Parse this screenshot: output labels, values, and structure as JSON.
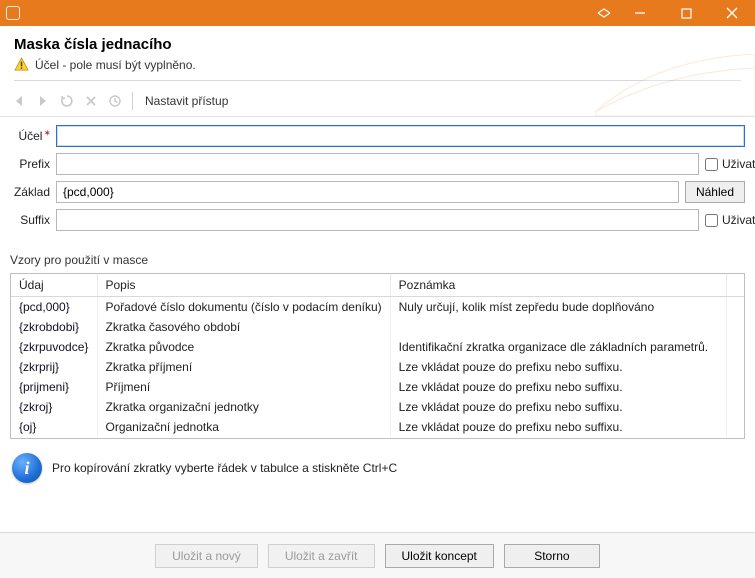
{
  "header": {
    "title": "Maska čísla jednacího",
    "warning": "Účel - pole musí být vyplněno."
  },
  "toolbar": {
    "access_label": "Nastavit přístup"
  },
  "form": {
    "ucel_label": "Účel",
    "ucel_value": "",
    "prefix_label": "Prefix",
    "prefix_value": "",
    "zaklad_label": "Základ",
    "zaklad_value": "{pcd,000}",
    "suffix_label": "Suffix",
    "suffix_value": "",
    "user_editable_label": "Uživatelsky editovatelné",
    "preview_button": "Náhled"
  },
  "patterns": {
    "section_title": "Vzory pro použití v masce",
    "columns": {
      "udaj": "Údaj",
      "popis": "Popis",
      "poznamka": "Poznámka"
    },
    "rows": [
      {
        "udaj": "{pcd,000}",
        "popis": "Pořadové číslo dokumentu (číslo v podacím deníku)",
        "pozn": "Nuly určují, kolik míst zepředu bude doplňováno"
      },
      {
        "udaj": "{zkrobdobi}",
        "popis": "Zkratka časového období",
        "pozn": ""
      },
      {
        "udaj": "{zkrpuvodce}",
        "popis": "Zkratka původce",
        "pozn": "Identifikační zkratka organizace dle základních parametrů."
      },
      {
        "udaj": "{zkrprij}",
        "popis": "Zkratka příjmení",
        "pozn": "Lze vkládat pouze do prefixu nebo suffixu."
      },
      {
        "udaj": "{prijmeni}",
        "popis": "Příjmení",
        "pozn": "Lze vkládat pouze do prefixu nebo suffixu."
      },
      {
        "udaj": "{zkroj}",
        "popis": "Zkratka organizační jednotky",
        "pozn": "Lze vkládat pouze do prefixu nebo suffixu."
      },
      {
        "udaj": "{oj}",
        "popis": "Organizační jednotka",
        "pozn": "Lze vkládat pouze do prefixu nebo suffixu."
      }
    ]
  },
  "info": {
    "text": "Pro kopírování zkratky vyberte řádek v tabulce a stiskněte Ctrl+C"
  },
  "buttons": {
    "save_new": "Uložit a nový",
    "save_close": "Uložit a zavřít",
    "save_draft": "Uložit koncept",
    "cancel": "Storno"
  }
}
